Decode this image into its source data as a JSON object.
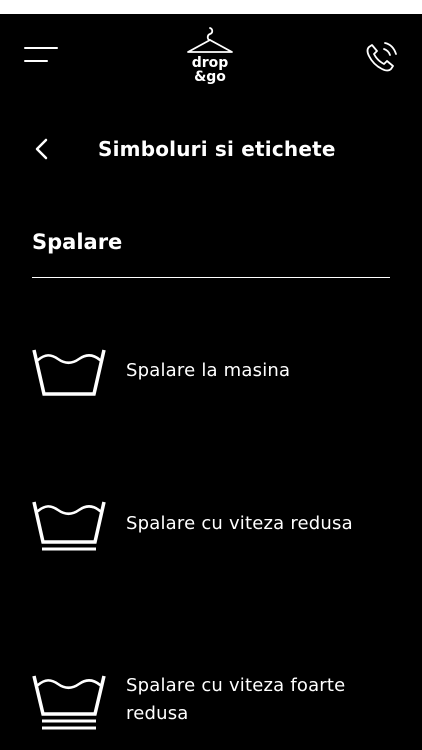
{
  "logo": {
    "line1": "drop",
    "line2": "&go"
  },
  "header": {
    "title": "Simboluri si etichete"
  },
  "section": {
    "title": "Spalare"
  },
  "items": [
    {
      "label": "Spalare la masina",
      "icon": "washtub-icon"
    },
    {
      "label": "Spalare cu viteza redusa",
      "icon": "washtub-gentle-icon"
    },
    {
      "label": "Spalare cu viteza foarte redusa",
      "icon": "washtub-very-gentle-icon"
    }
  ],
  "colors": {
    "background": "#000000",
    "foreground": "#ffffff"
  }
}
